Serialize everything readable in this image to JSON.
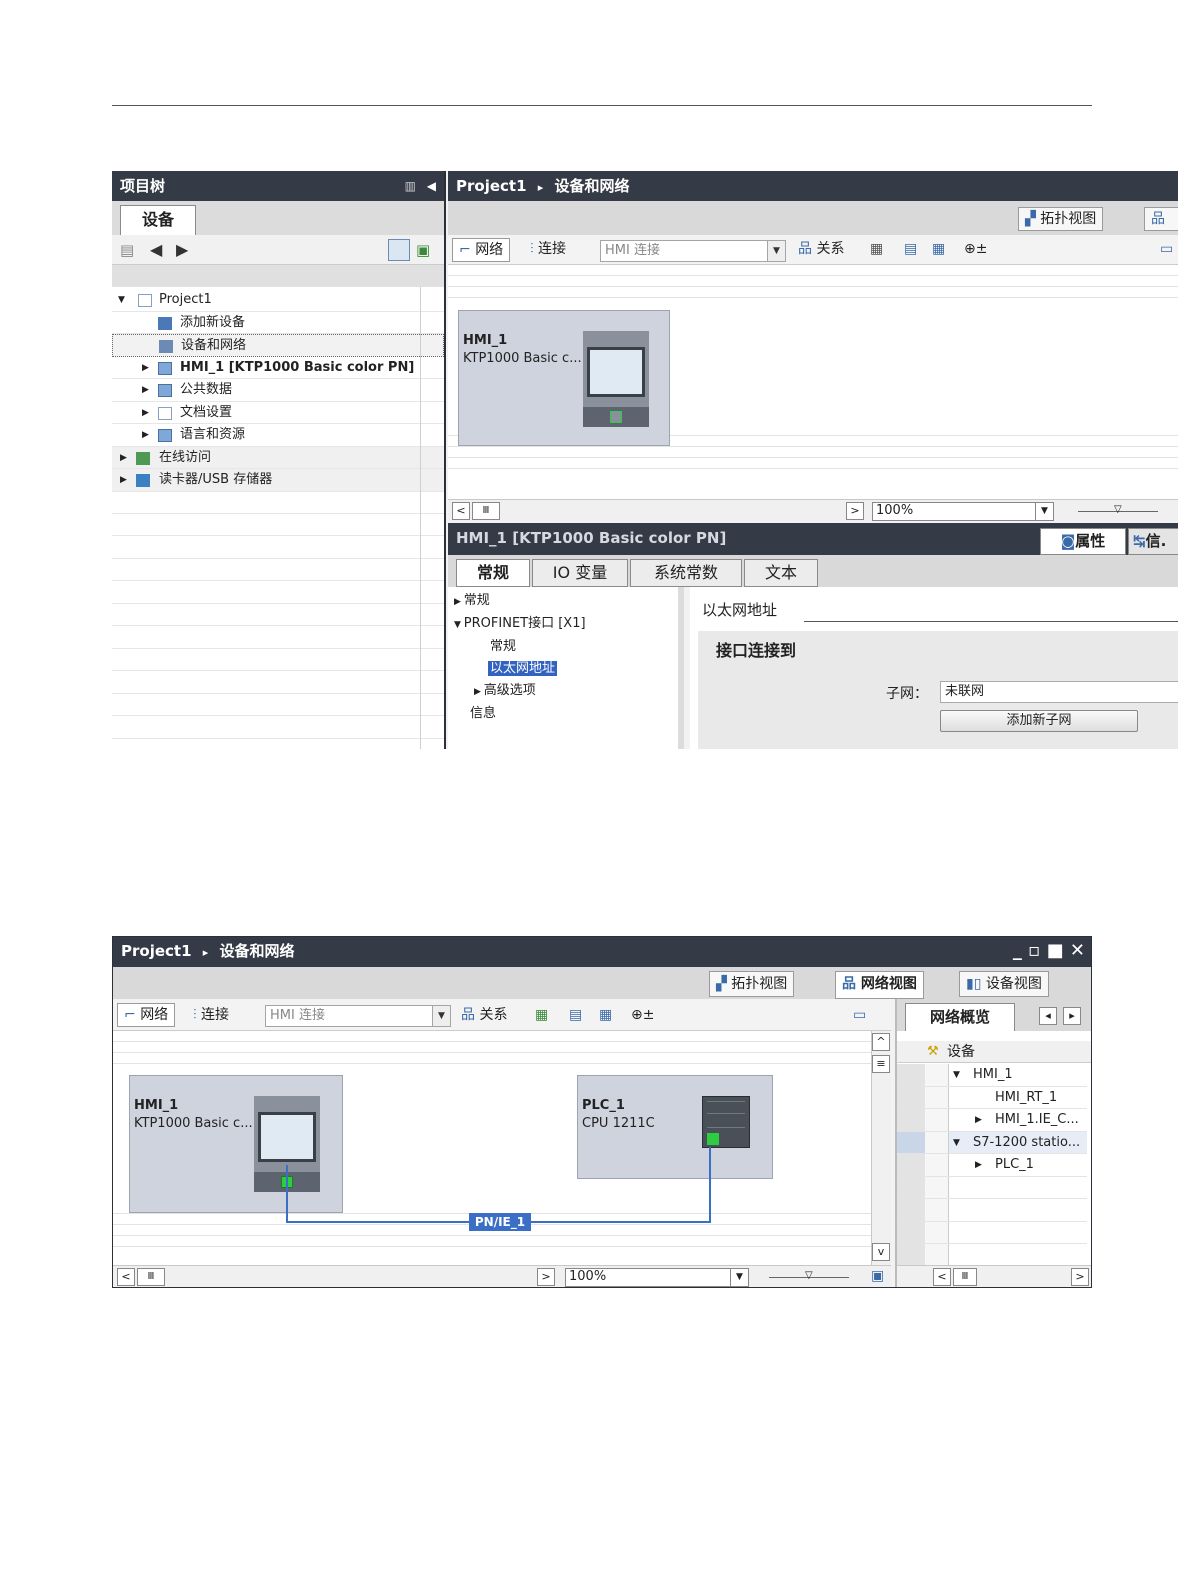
{
  "screenshot1": {
    "project_tree": {
      "title": "项目树",
      "tab_label": "设备",
      "items": [
        {
          "label": "Project1",
          "expanded": true
        },
        {
          "label": "添加新设备"
        },
        {
          "label": "设备和网络",
          "selected": true
        },
        {
          "label": "HMI_1 [KTP1000 Basic color PN]"
        },
        {
          "label": "公共数据"
        },
        {
          "label": "文档设置"
        },
        {
          "label": "语言和资源"
        },
        {
          "label": "在线访问"
        },
        {
          "label": "读卡器/USB 存储器"
        }
      ]
    },
    "editor": {
      "breadcrumb_project": "Project1",
      "breadcrumb_sep": "▸",
      "breadcrumb_page": "设备和网络",
      "view_tab_topology": "拓扑视图",
      "toolbar": {
        "network": "网络",
        "connection": "连接",
        "connection_type": "HMI 连接",
        "relation": "关系"
      },
      "device": {
        "name": "HMI_1",
        "type": "KTP1000 Basic c..."
      },
      "zoom": "100%"
    },
    "properties": {
      "title": "HMI_1 [KTP1000 Basic color PN]",
      "tab_properties": "属性",
      "tab_info": "信.",
      "tabs": [
        "常规",
        "IO 变量",
        "系统常数",
        "文本"
      ],
      "nav": {
        "general": "常规",
        "profinet": "PROFINET接口 [X1]",
        "sub_general": "常规",
        "ethernet": "以太网地址",
        "advanced": "高级选项",
        "info": "信息"
      },
      "section_title": "以太网地址",
      "group_title": "接口连接到",
      "subnet_label": "子网：",
      "subnet_value": "未联网",
      "add_subnet_button": "添加新子网"
    }
  },
  "screenshot2": {
    "breadcrumb_project": "Project1",
    "breadcrumb_sep": "▸",
    "breadcrumb_page": "设备和网络",
    "window_controls": "_ ▫ ■ ✕",
    "view_tabs": [
      "拓扑视图",
      "网络视图",
      "设备视图"
    ],
    "toolbar": {
      "network": "网络",
      "connection": "连接",
      "connection_type": "HMI 连接",
      "relation": "关系"
    },
    "devices": [
      {
        "name": "HMI_1",
        "type": "KTP1000 Basic c..."
      },
      {
        "name": "PLC_1",
        "type": "CPU 1211C"
      }
    ],
    "network_label": "PN/IE_1",
    "zoom": "100%",
    "overview": {
      "tab_label": "网络概览",
      "column_device": "设备",
      "rows": [
        "HMI_1",
        "HMI_RT_1",
        "HMI_1.IE_C...",
        "S7-1200 statio...",
        "PLC_1"
      ]
    }
  }
}
